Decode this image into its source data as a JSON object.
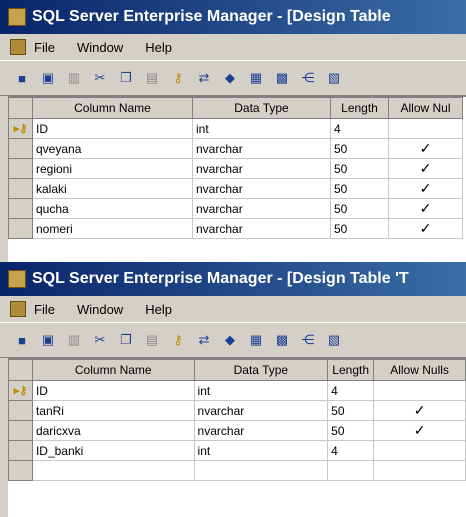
{
  "window1": {
    "title": "SQL Server Enterprise Manager - [Design Table",
    "menus": [
      "File",
      "Window",
      "Help"
    ],
    "columns": [
      "Column Name",
      "Data Type",
      "Length",
      "Allow Nul"
    ],
    "rows": [
      {
        "name": "ID",
        "type": "int",
        "length": "4",
        "nulls": "",
        "key": true
      },
      {
        "name": "qveyana",
        "type": "nvarchar",
        "length": "50",
        "nulls": "✓",
        "key": false
      },
      {
        "name": "regioni",
        "type": "nvarchar",
        "length": "50",
        "nulls": "✓",
        "key": false
      },
      {
        "name": "kalaki",
        "type": "nvarchar",
        "length": "50",
        "nulls": "✓",
        "key": false
      },
      {
        "name": "qucha",
        "type": "nvarchar",
        "length": "50",
        "nulls": "✓",
        "key": false
      },
      {
        "name": "nomeri",
        "type": "nvarchar",
        "length": "50",
        "nulls": "✓",
        "key": false
      }
    ]
  },
  "window2": {
    "title": "SQL Server Enterprise Manager - [Design Table 'T",
    "menus": [
      "File",
      "Window",
      "Help"
    ],
    "columns": [
      "Column Name",
      "Data Type",
      "Length",
      "Allow Nulls"
    ],
    "rows": [
      {
        "name": "ID",
        "type": "int",
        "length": "4",
        "nulls": "",
        "key": true
      },
      {
        "name": "tanRi",
        "type": "nvarchar",
        "length": "50",
        "nulls": "✓",
        "key": false
      },
      {
        "name": "daricxva",
        "type": "nvarchar",
        "length": "50",
        "nulls": "✓",
        "key": false
      },
      {
        "name": "ID_banki",
        "type": "int",
        "length": "4",
        "nulls": "",
        "key": false
      }
    ]
  },
  "toolbar_icons": [
    "save-icon",
    "properties-icon",
    "insert-column-icon",
    "cut-icon",
    "copy-icon",
    "paste-icon",
    "primary-key-icon",
    "manage-relationships-icon",
    "indexes-icon",
    "constraints-icon",
    "triggers-icon",
    "dependencies-icon",
    "generate-script-icon"
  ],
  "key_marker": "▸🔑"
}
